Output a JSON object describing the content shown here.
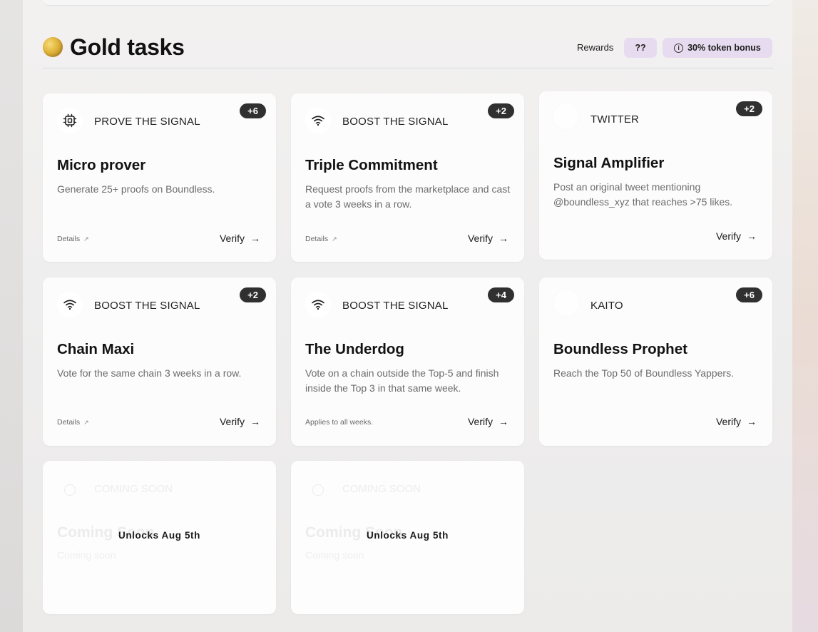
{
  "header": {
    "title": "Gold tasks",
    "rewards_label": "Rewards",
    "rewards_value": "??",
    "bonus_label": "30% token bonus"
  },
  "tasks": [
    {
      "category": "PROVE THE SIGNAL",
      "points": "+6",
      "title": "Micro prover",
      "description": "Generate 25+ proofs on Boundless.",
      "footer": "Details",
      "verify": "Verify",
      "icon": "chip-icon"
    },
    {
      "category": "BOOST THE SIGNAL",
      "points": "+2",
      "title": "Triple Commitment",
      "description": "Request proofs from the marketplace and cast a vote 3 weeks in a row.",
      "footer": "Details",
      "verify": "Verify",
      "icon": "wifi-icon"
    },
    {
      "category": "TWITTER",
      "points": "+2",
      "title": "Signal Amplifier",
      "description": "Post an original tweet mentioning @boundless_xyz that reaches >75 likes.",
      "footer": "",
      "verify": "Verify",
      "icon": "twitter-icon"
    },
    {
      "category": "BOOST THE SIGNAL",
      "points": "+2",
      "title": "Chain Maxi",
      "description": "Vote for the same chain 3 weeks in a row.",
      "footer": "Details",
      "verify": "Verify",
      "icon": "wifi-icon"
    },
    {
      "category": "BOOST THE SIGNAL",
      "points": "+4",
      "title": "The Underdog",
      "description": "Vote on a chain outside the Top-5 and finish inside the Top 3 in that same week.",
      "footer": "Applies to all weeks.",
      "verify": "Verify",
      "icon": "wifi-icon"
    },
    {
      "category": "KAITO",
      "points": "+6",
      "title": "Boundless Prophet",
      "description": "Reach the Top 50 of Boundless Yappers.",
      "footer": "",
      "verify": "Verify",
      "icon": "kaito-icon"
    }
  ],
  "locked": [
    {
      "category": "COMING SOON",
      "title": "Coming Soon",
      "subtitle": "Coming soon",
      "unlock_text": "Unlocks Aug 5th"
    },
    {
      "category": "COMING SOON",
      "title": "Coming Soon",
      "subtitle": "Coming soon",
      "unlock_text": "Unlocks Aug 5th"
    }
  ]
}
